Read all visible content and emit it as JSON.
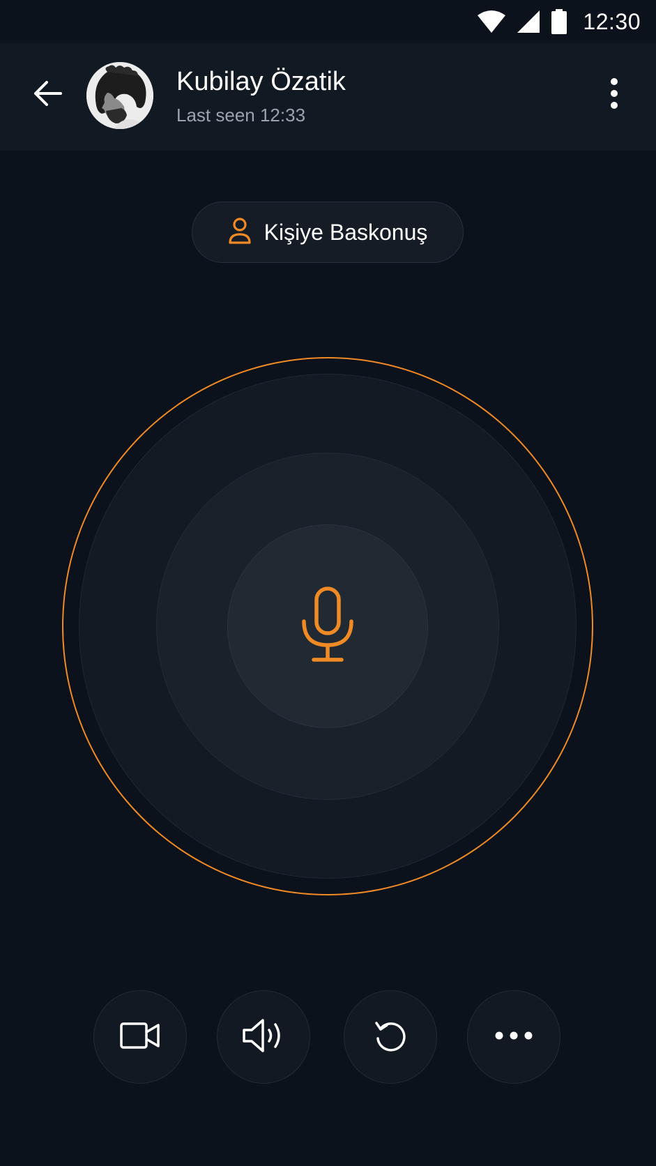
{
  "status_bar": {
    "time": "12:30",
    "icons": [
      "wifi-icon",
      "signal-icon",
      "battery-icon"
    ]
  },
  "header": {
    "contact_name": "Kubilay Özatik",
    "contact_status": "Last seen 12:33",
    "icons": [
      "arrow-left-icon",
      "more-vertical-icon"
    ]
  },
  "ptt": {
    "label": "Kişiye Baskonuş",
    "icon": "person-icon"
  },
  "mic": {
    "icon": "microphone-icon"
  },
  "controls": [
    {
      "name": "video",
      "icon": "video-camera-icon"
    },
    {
      "name": "speaker",
      "icon": "speaker-icon"
    },
    {
      "name": "refresh",
      "icon": "refresh-icon"
    },
    {
      "name": "more",
      "icon": "more-horizontal-icon"
    }
  ],
  "colors": {
    "accent": "#f08a24",
    "background": "#0b121c",
    "header": "#111923",
    "secondary_text": "#9aa3ae"
  }
}
